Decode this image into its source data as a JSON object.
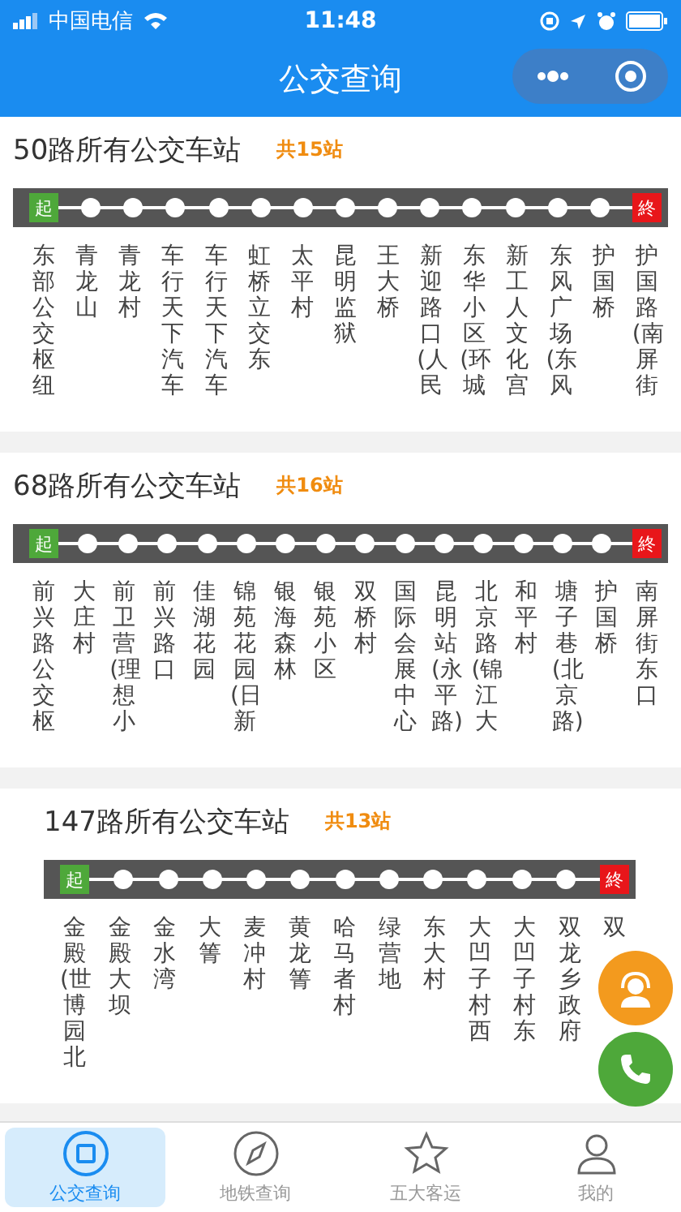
{
  "status_bar": {
    "carrier": "中国电信",
    "time": "11:48"
  },
  "nav": {
    "title": "公交查询"
  },
  "routes": [
    {
      "title": "50路所有公交车站",
      "count": "共15站",
      "start": "起",
      "end": "終",
      "stations": [
        "东部公交枢纽",
        "青龙山",
        "青龙村",
        "车行天下汽车",
        "车行天下汽车",
        "虹桥立交东",
        "太平村",
        "昆明监狱",
        "王大桥",
        "新迎路口(人民",
        "东华小区(环城",
        "新工人文化宫",
        "东风广场(东风",
        "护国桥",
        "护国路(南屏街"
      ]
    },
    {
      "title": "68路所有公交车站",
      "count": "共16站",
      "start": "起",
      "end": "終",
      "stations": [
        "前兴路公交枢",
        "大庄村",
        "前卫营(理想小",
        "前兴路口",
        "佳湖花园",
        "锦苑花园(日新",
        "银海森林",
        "银苑小区",
        "双桥村",
        "国际会展中心",
        "昆明站(永平路)",
        "北京路(锦江大",
        "和平村",
        "塘子巷(北京路)",
        "护国桥",
        "南屏街东口"
      ]
    },
    {
      "title": "147路所有公交车站",
      "count": "共13站",
      "start": "起",
      "end": "終",
      "stations": [
        "金殿(世博园北",
        "金殿大坝",
        "金水湾",
        "大箐",
        "麦冲村",
        "黄龙箐",
        "哈马者村",
        "绿营地",
        "东大村",
        "大凹子村西",
        "大凹子村东",
        "双龙乡政府",
        "双"
      ]
    }
  ],
  "tabs": [
    {
      "label": "公交查询",
      "selected": true
    },
    {
      "label": "地铁查询",
      "selected": false
    },
    {
      "label": "五大客运",
      "selected": false
    },
    {
      "label": "我的",
      "selected": false
    }
  ]
}
